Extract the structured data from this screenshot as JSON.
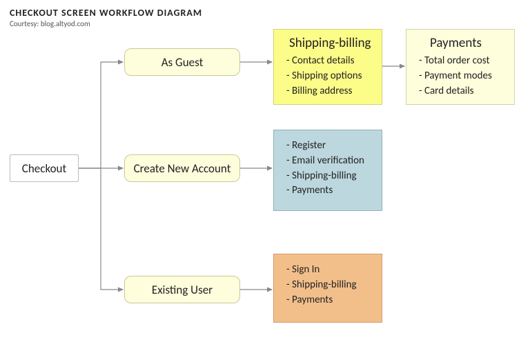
{
  "header": {
    "title": "CHECKOUT SCREEN WORKFLOW DIAGRAM",
    "courtesy": "Courtesy: blog.altyod.com"
  },
  "nodes": {
    "checkout": "Checkout",
    "guest": "As Guest",
    "create": "Create New Account",
    "existing": "Existing User"
  },
  "shipping": {
    "title": "Shipping-billing",
    "items": [
      "- Contact details",
      "- Shipping options",
      "- Billing address"
    ]
  },
  "payments": {
    "title": "Payments",
    "items": [
      "- Total order cost",
      "- Payment modes",
      "- Card details"
    ]
  },
  "createDetail": {
    "items": [
      "- Register",
      "- Email verification",
      "- Shipping-billing",
      "- Payments"
    ]
  },
  "existingDetail": {
    "items": [
      "- Sign In",
      "- Shipping-billing",
      "- Payments"
    ]
  }
}
